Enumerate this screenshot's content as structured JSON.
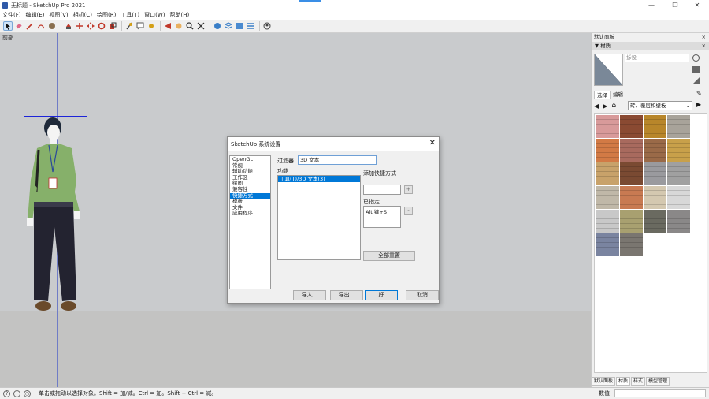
{
  "window": {
    "title": "无标题 - SketchUp Pro 2021",
    "minimize": "—",
    "maximize": "❐",
    "close": "✕"
  },
  "menu": [
    "文件(F)",
    "编辑(E)",
    "视图(V)",
    "相机(C)",
    "绘图(R)",
    "工具(T)",
    "窗口(W)",
    "帮助(H)"
  ],
  "toolbar": {
    "icons": [
      "select-icon",
      "eraser-icon",
      "line-icon",
      "arc-icon",
      "paint-bucket-icon",
      "push-pull-icon",
      "move-icon",
      "rotate-icon",
      "scale-icon",
      "tape-measure-icon",
      "text-icon",
      "orbit-icon",
      "pan-icon",
      "zoom-icon",
      "zoom-extents-icon",
      "warehouse-icon",
      "extension-icon"
    ]
  },
  "scene": {
    "label": "前部"
  },
  "dialog": {
    "title": "SketchUp 系统设置",
    "close": "✕",
    "nav": [
      "OpenGL",
      "常规",
      "辅助功能",
      "工作区",
      "绘图",
      "兼容性",
      "快捷方式",
      "模板",
      "文件",
      "应用程序"
    ],
    "nav_selected": 6,
    "filter_label": "过滤器",
    "filter_value": "3D 文本",
    "function_label": "功能",
    "function_item": "工具(T)/3D 文本(3)",
    "add_shortcut_label": "添加快捷方式",
    "plus": "+",
    "minus": "-",
    "assigned_label": "已指定",
    "assigned_value": "Alt 键+S",
    "reset_all": "全部重置",
    "import": "导入...",
    "export": "导出...",
    "ok": "好",
    "cancel": "取消"
  },
  "panel": {
    "title": "默认面板",
    "tray_title": "▼ 材质",
    "preset_placeholder": "拆设",
    "tab_select": "选择",
    "tab_edit": "编辑",
    "category": "砖、覆层和壁板",
    "bottom_tabs": [
      "默认面板",
      "材质",
      "样式",
      "模型管理"
    ],
    "bottom_selected": 1,
    "swatch_colors": [
      "#d89a9a",
      "#8a4a32",
      "#b8862a",
      "#a8a39a",
      "#d27a45",
      "#a86a5e",
      "#9a6a48",
      "#c8a04a",
      "#c8a26a",
      "#7a4a32",
      "#9a9a9e",
      "#a0a0a0",
      "#c0b8a8",
      "#c87a52",
      "#d4c8b0",
      "#d8d8d8",
      "#c8c8c8",
      "#a8a070",
      "#6a6a60",
      "#8a8888",
      "#7a84a0",
      "#7a7670"
    ]
  },
  "status": {
    "hint": "单击或拖动以选择对象。Shift = 加/减。Ctrl = 加。Shift + Ctrl = 减。",
    "value_label": "数值"
  }
}
